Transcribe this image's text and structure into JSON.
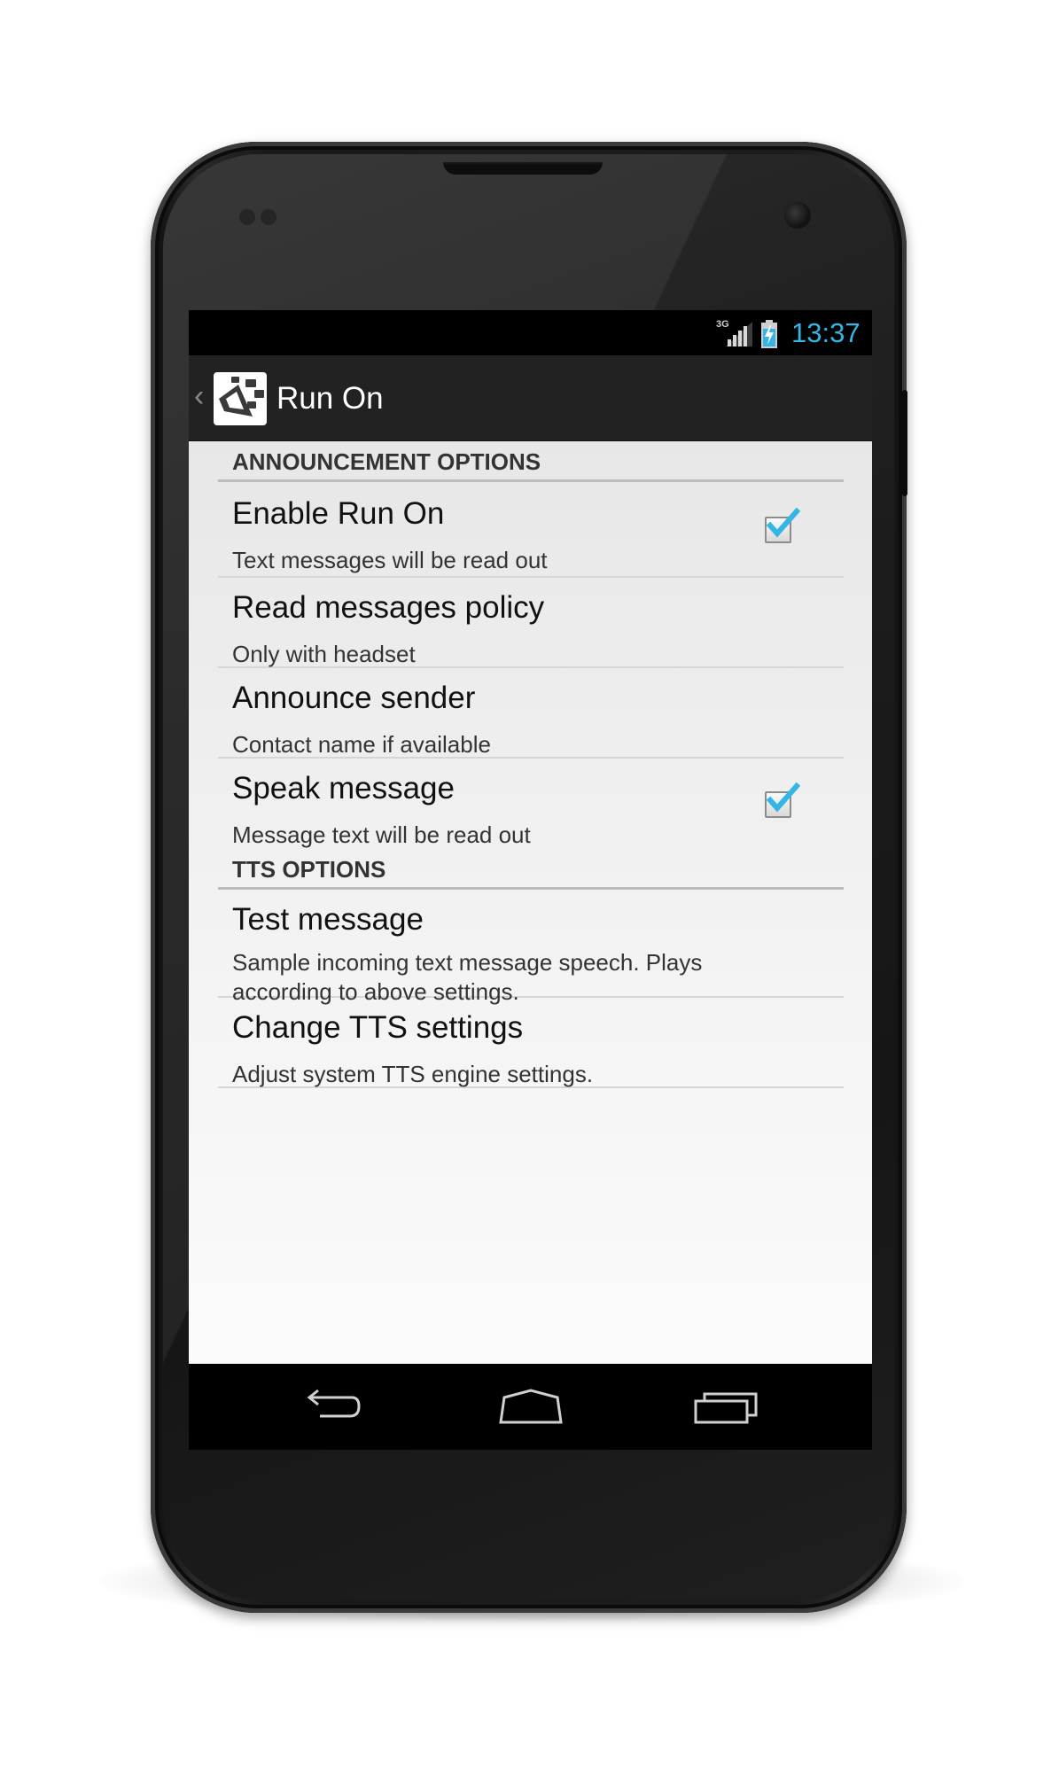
{
  "status_bar": {
    "network_label": "3G",
    "time": "13:37",
    "accent_color": "#33b5e5",
    "icons": [
      "signal-icon",
      "battery-charging-icon"
    ]
  },
  "action_bar": {
    "title": "Run On",
    "icons": [
      "up-caret-icon",
      "app-icon"
    ]
  },
  "sections": [
    {
      "header": "ANNOUNCEMENT OPTIONS",
      "items": [
        {
          "title": "Enable Run On",
          "summary": "Text messages will be read out",
          "checked": true
        },
        {
          "title": "Read messages policy",
          "summary": "Only with headset"
        },
        {
          "title": "Announce sender",
          "summary": "Contact name if available"
        },
        {
          "title": "Speak message",
          "summary": "Message text will be read out",
          "checked": true
        }
      ]
    },
    {
      "header": "TTS OPTIONS",
      "items": [
        {
          "title": "Test message",
          "summary": "Sample incoming text message speech. Plays according to above settings."
        },
        {
          "title": "Change TTS settings",
          "summary": "Adjust system TTS engine settings."
        }
      ]
    }
  ],
  "nav_bar": {
    "icons": [
      "back-icon",
      "home-icon",
      "recent-apps-icon"
    ]
  },
  "colors": {
    "check_blue": "#33b5e5",
    "action_bar": "#222222",
    "background": "#ececec"
  }
}
